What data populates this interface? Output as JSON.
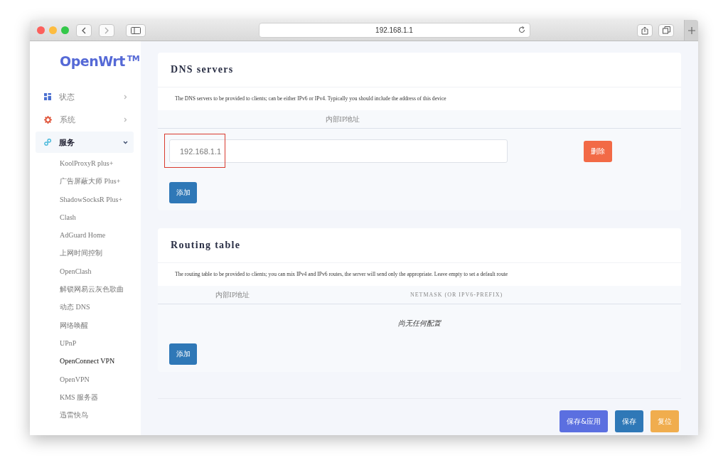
{
  "browser": {
    "address": "192.168.1.1"
  },
  "sidebar": {
    "logo": "OpenWrt",
    "logo_mark": "TM",
    "menu": [
      {
        "kind": "status",
        "label": "状态",
        "expanded": false,
        "selected": false
      },
      {
        "kind": "system",
        "label": "系统",
        "expanded": false,
        "selected": false
      },
      {
        "kind": "services",
        "label": "服务",
        "expanded": true,
        "selected": true,
        "children": [
          {
            "label": "KoolProxyR plus+",
            "selected": false
          },
          {
            "label": "广告屏蔽大师 Plus+",
            "selected": false
          },
          {
            "label": "ShadowSocksR Plus+",
            "selected": false
          },
          {
            "label": "Clash",
            "selected": false
          },
          {
            "label": "AdGuard Home",
            "selected": false
          },
          {
            "label": "上网时间控制",
            "selected": false
          },
          {
            "label": "OpenClash",
            "selected": false
          },
          {
            "label": "解锁网易云灰色歌曲",
            "selected": false
          },
          {
            "label": "动态 DNS",
            "selected": false
          },
          {
            "label": "网络唤醒",
            "selected": false
          },
          {
            "label": "UPnP",
            "selected": false
          },
          {
            "label": "OpenConnect VPN",
            "selected": true
          },
          {
            "label": "OpenVPN",
            "selected": false
          },
          {
            "label": "KMS 服务器",
            "selected": false
          },
          {
            "label": "迅雷快鸟",
            "selected": false
          }
        ]
      }
    ]
  },
  "dns": {
    "title": "DNS servers",
    "description": "The DNS servers to be provided to clients; can be either IPv6 or IPv4. Typically you should include the address of this device",
    "column": "内部IP地址",
    "entries": [
      {
        "value": "192.168.1.1",
        "highlighted": true,
        "delete": "删除"
      }
    ],
    "add": "添加"
  },
  "routing": {
    "title": "Routing table",
    "description": "The routing table to be provided to clients; you can mix IPv4 and IPv6 routes, the server will send only the appropriate. Leave empty to set a default route",
    "columns": [
      "内部IP地址",
      "NETMASK (OR IPV6-PREFIX)"
    ],
    "empty": "尚无任何配置",
    "add": "添加"
  },
  "actions": [
    {
      "kind": "apply",
      "label": "保存&应用"
    },
    {
      "kind": "save",
      "label": "保存"
    },
    {
      "kind": "reset",
      "label": "复位"
    }
  ]
}
